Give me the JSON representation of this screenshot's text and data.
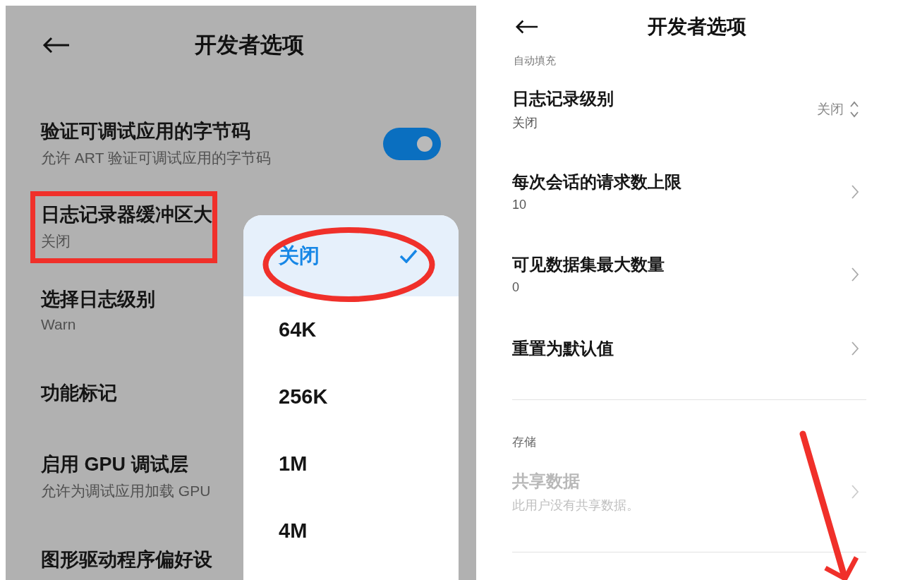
{
  "left_screen": {
    "title": "开发者选项",
    "settings": [
      {
        "kind": "toggle",
        "title": "验证可调试应用的字节码",
        "subtitle": "允许 ART 验证可调试应用的字节码",
        "on": true,
        "highlighted": false
      },
      {
        "kind": "value",
        "title": "日志记录器缓冲区大",
        "subtitle": "关闭",
        "highlighted": true
      },
      {
        "kind": "value",
        "title": "选择日志级别",
        "subtitle": "Warn",
        "highlighted": false
      },
      {
        "kind": "value",
        "title": "功能标记",
        "highlighted": false
      },
      {
        "kind": "value",
        "title": "启用 GPU 调试层",
        "subtitle": "允许为调试应用加载 GPU",
        "highlighted": false
      },
      {
        "kind": "value",
        "title": "图形驱动程序偏好设",
        "highlighted": false
      }
    ],
    "popup": {
      "options": [
        {
          "label": "关闭",
          "selected": true,
          "circled": true
        },
        {
          "label": "64K",
          "selected": false,
          "circled": false
        },
        {
          "label": "256K",
          "selected": false,
          "circled": false
        },
        {
          "label": "1M",
          "selected": false,
          "circled": false
        },
        {
          "label": "4M",
          "selected": false,
          "circled": false
        }
      ]
    }
  },
  "right_screen": {
    "title": "开发者选项",
    "cut_section_header": "自动填充",
    "settings": [
      {
        "kind": "picker",
        "title": "日志记录级别",
        "subtitle": "关闭",
        "value": "关闭"
      },
      {
        "kind": "link",
        "title": "每次会话的请求数上限",
        "subtitle": "10"
      },
      {
        "kind": "link",
        "title": "可见数据集最大数量",
        "subtitle": "0"
      },
      {
        "kind": "link",
        "title": "重置为默认值"
      }
    ],
    "storage_section": {
      "header": "存储",
      "settings": [
        {
          "kind": "link",
          "title": "共享数据",
          "subtitle": "此用户没有共享数据。",
          "disabled": true
        }
      ]
    }
  }
}
